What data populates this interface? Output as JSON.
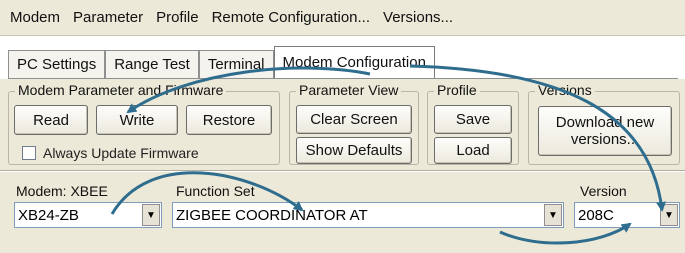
{
  "menu": [
    "Modem",
    "Parameter",
    "Profile",
    "Remote Configuration...",
    "Versions..."
  ],
  "tabs": [
    {
      "label": "PC Settings"
    },
    {
      "label": "Range Test"
    },
    {
      "label": "Terminal"
    },
    {
      "label": "Modem Configuration",
      "active": true
    }
  ],
  "groups": {
    "modem_param": {
      "legend": "Modem Parameter and Firmware",
      "read": "Read",
      "write": "Write",
      "restore": "Restore",
      "always_update": "Always Update Firmware",
      "always_update_checked": false
    },
    "param_view": {
      "legend": "Parameter View",
      "clear_screen": "Clear Screen",
      "show_defaults": "Show Defaults"
    },
    "profile": {
      "legend": "Profile",
      "save": "Save",
      "load": "Load"
    },
    "versions": {
      "legend": "Versions",
      "download": "Download new versions..."
    }
  },
  "settings": {
    "modem_label": "Modem: XBEE",
    "modem_value": "XB24-ZB",
    "function_label": "Function Set",
    "function_value": "ZIGBEE COORDINATOR AT",
    "version_label": "Version",
    "version_value": "208C"
  },
  "colors": {
    "annotation_arrow": "#2f6d8e",
    "panel_bg": "#ece9d8",
    "combo_border": "#7f9db9"
  }
}
